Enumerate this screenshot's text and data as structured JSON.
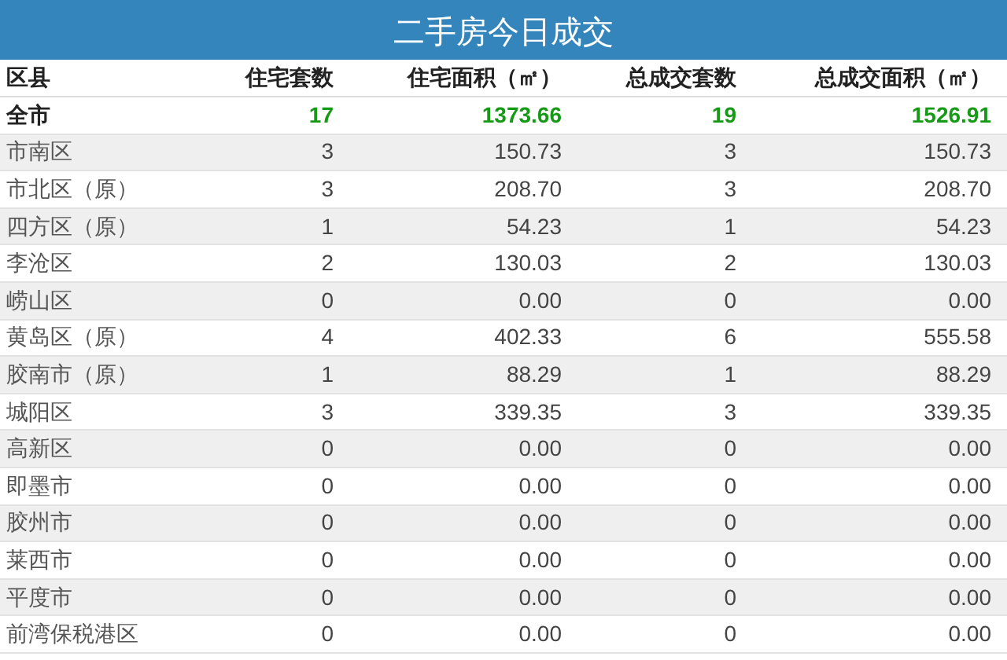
{
  "title": "二手房今日成交",
  "columns": [
    "区县",
    "住宅套数",
    "住宅面积（㎡）",
    "总成交套数",
    "总成交面积（㎡）"
  ],
  "rows": [
    {
      "kind": "total",
      "cells": [
        "全市",
        "17",
        "1373.66",
        "19",
        "1526.91"
      ]
    },
    {
      "kind": "district",
      "cells": [
        "市南区",
        "3",
        "150.73",
        "3",
        "150.73"
      ]
    },
    {
      "kind": "district",
      "cells": [
        "市北区（原）",
        "3",
        "208.70",
        "3",
        "208.70"
      ]
    },
    {
      "kind": "district",
      "cells": [
        "四方区（原）",
        "1",
        "54.23",
        "1",
        "54.23"
      ]
    },
    {
      "kind": "district",
      "cells": [
        "李沧区",
        "2",
        "130.03",
        "2",
        "130.03"
      ]
    },
    {
      "kind": "district",
      "cells": [
        "崂山区",
        "0",
        "0.00",
        "0",
        "0.00"
      ]
    },
    {
      "kind": "district",
      "cells": [
        "黄岛区（原）",
        "4",
        "402.33",
        "6",
        "555.58"
      ]
    },
    {
      "kind": "district",
      "cells": [
        "胶南市（原）",
        "1",
        "88.29",
        "1",
        "88.29"
      ]
    },
    {
      "kind": "district",
      "cells": [
        "城阳区",
        "3",
        "339.35",
        "3",
        "339.35"
      ]
    },
    {
      "kind": "district",
      "cells": [
        "高新区",
        "0",
        "0.00",
        "0",
        "0.00"
      ]
    },
    {
      "kind": "district",
      "cells": [
        "即墨市",
        "0",
        "0.00",
        "0",
        "0.00"
      ]
    },
    {
      "kind": "district",
      "cells": [
        "胶州市",
        "0",
        "0.00",
        "0",
        "0.00"
      ]
    },
    {
      "kind": "district",
      "cells": [
        "莱西市",
        "0",
        "0.00",
        "0",
        "0.00"
      ]
    },
    {
      "kind": "district",
      "cells": [
        "平度市",
        "0",
        "0.00",
        "0",
        "0.00"
      ]
    },
    {
      "kind": "district",
      "cells": [
        "前湾保税港区",
        "0",
        "0.00",
        "0",
        "0.00"
      ]
    }
  ]
}
